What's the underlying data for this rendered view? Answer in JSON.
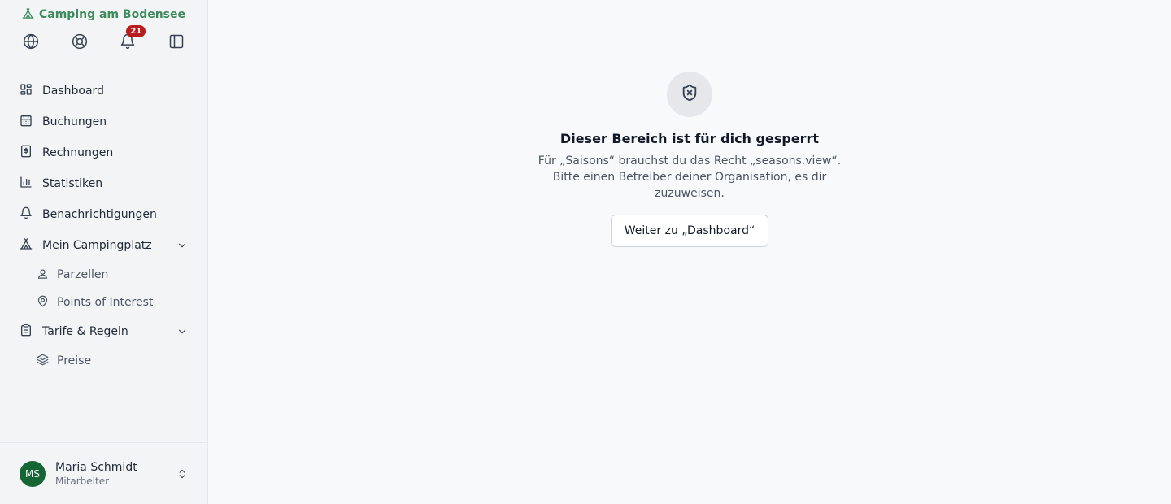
{
  "brand": {
    "name": "Camping am Bodensee"
  },
  "toolbar": {
    "notifications_count": "21"
  },
  "nav": {
    "items": [
      {
        "label": "Dashboard",
        "icon": "dashboard-icon"
      },
      {
        "label": "Buchungen",
        "icon": "calendar-icon"
      },
      {
        "label": "Rechnungen",
        "icon": "receipt-icon"
      },
      {
        "label": "Statistiken",
        "icon": "bar-chart-icon"
      },
      {
        "label": "Benachrichtigungen",
        "icon": "bell-icon"
      }
    ],
    "groups": [
      {
        "label": "Mein Campingplatz",
        "icon": "tent-icon",
        "children": [
          {
            "label": "Parzellen",
            "icon": "pitch-icon"
          },
          {
            "label": "Points of Interest",
            "icon": "map-pin-icon"
          }
        ]
      },
      {
        "label": "Tarife & Regeln",
        "icon": "clipboard-icon",
        "children": [
          {
            "label": "Preise",
            "icon": "layers-icon"
          }
        ]
      }
    ]
  },
  "user": {
    "initials": "MS",
    "name": "Maria Schmidt",
    "role": "Mitarbeiter"
  },
  "main": {
    "title": "Dieser Bereich ist für dich gesperrt",
    "message": "Für „Saisons“ brauchst du das Recht „seasons.view“. Bitte einen Betreiber deiner Organisation, es dir zuzuweisen.",
    "button_label": "Weiter zu „Dashboard“"
  },
  "colors": {
    "brand": "#3d8b5c",
    "badge": "#b91c1c",
    "avatar": "#166534"
  }
}
